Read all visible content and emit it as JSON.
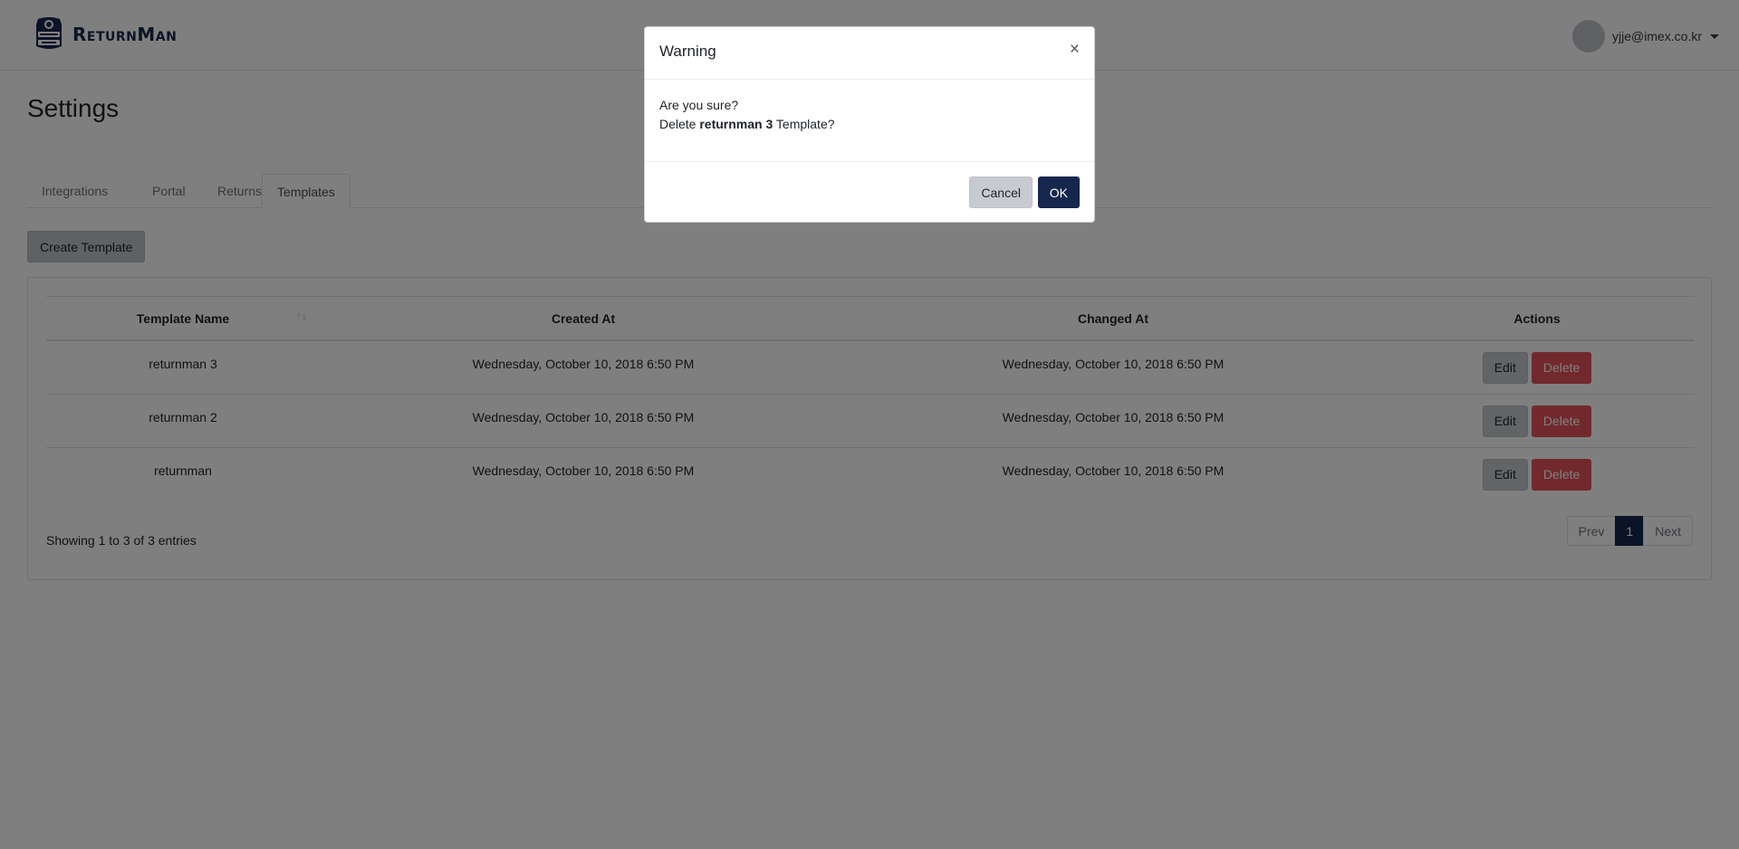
{
  "header": {
    "logo_text": "ReturnMan",
    "user_email": "yjje@imex.co.kr"
  },
  "page": {
    "title": "Settings",
    "tabs": [
      {
        "label": "Integrations",
        "active": false
      },
      {
        "label": "Portal",
        "active": false
      },
      {
        "label": "Returns",
        "active": false
      },
      {
        "label": "Templates",
        "active": true
      }
    ],
    "create_button": "Create Template"
  },
  "table": {
    "columns": [
      "Template Name",
      "Created At",
      "Changed At",
      "Actions"
    ],
    "rows": [
      {
        "name": "returnman 3",
        "created": "Wednesday, October 10, 2018 6:50 PM",
        "changed": "Wednesday, October 10, 2018 6:50 PM",
        "edit": "Edit",
        "delete": "Delete"
      },
      {
        "name": "returnman 2",
        "created": "Wednesday, October 10, 2018 6:50 PM",
        "changed": "Wednesday, October 10, 2018 6:50 PM",
        "edit": "Edit",
        "delete": "Delete"
      },
      {
        "name": "returnman",
        "created": "Wednesday, October 10, 2018 6:50 PM",
        "changed": "Wednesday, October 10, 2018 6:50 PM",
        "edit": "Edit",
        "delete": "Delete"
      }
    ],
    "entries_text": "Showing 1 to 3 of 3 entries",
    "pagination": {
      "prev": "Prev",
      "current": "1",
      "next": "Next"
    }
  },
  "modal": {
    "title": "Warning",
    "close": "×",
    "line1": "Are you sure?",
    "line2_prefix": "Delete ",
    "line2_bold": "returnman 3",
    "line2_suffix": " Template?",
    "cancel": "Cancel",
    "ok": "OK"
  },
  "colors": {
    "brand": "#16274d",
    "danger": "#e4525a",
    "backdrop": "rgba(0,0,0,0.5)"
  }
}
